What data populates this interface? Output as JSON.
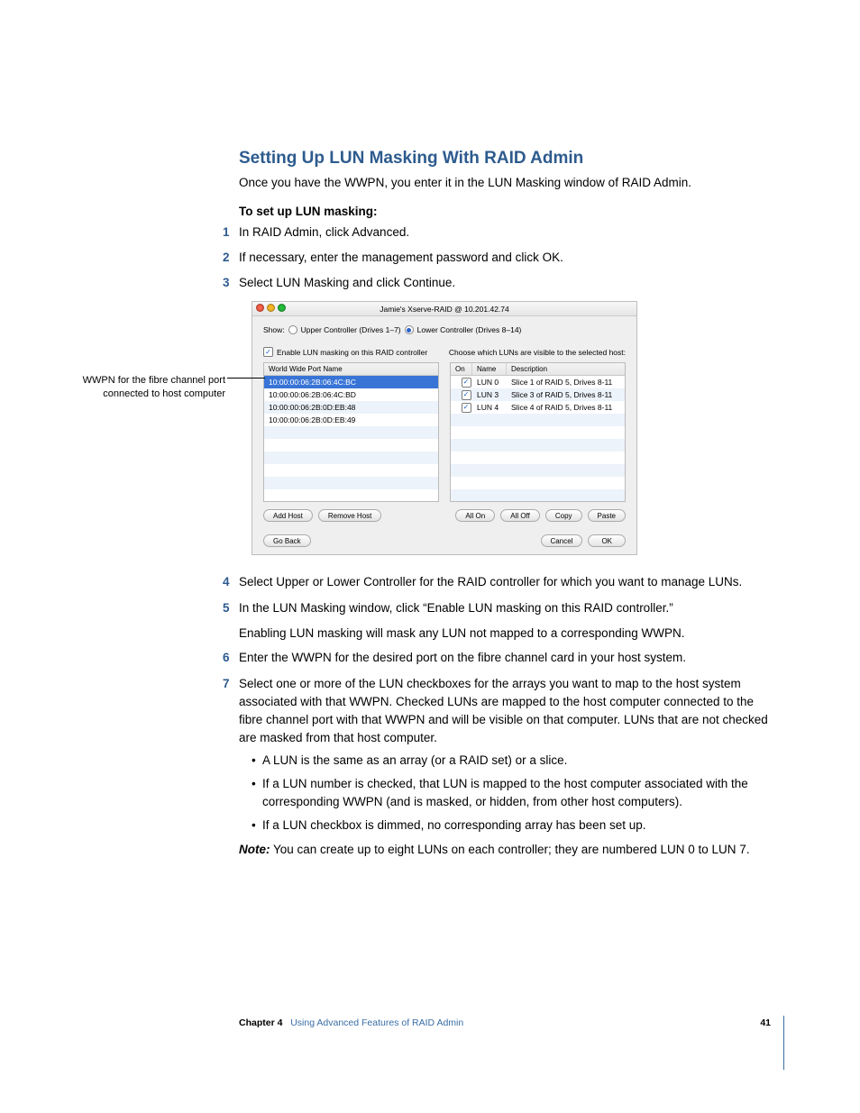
{
  "heading": "Setting Up LUN Masking With RAID Admin",
  "intro": "Once you have the WWPN, you enter it in the LUN Masking window of RAID Admin.",
  "sub_head": "To set up LUN masking:",
  "steps_a": [
    "In RAID Admin, click Advanced.",
    "If necessary, enter the management password and click OK.",
    "Select LUN Masking and click Continue."
  ],
  "callout": "WWPN for the fibre channel port connected to host computer",
  "dialog": {
    "title": "Jamie's Xserve-RAID @ 10.201.42.74",
    "show_label": "Show:",
    "upper_label": "Upper Controller (Drives 1–7)",
    "lower_label": "Lower Controller (Drives 8–14)",
    "enable_label": "Enable LUN masking on this RAID controller",
    "choose_label": "Choose which LUNs are visible to the selected host:",
    "left_header": "World Wide Port Name",
    "wwpns": [
      "10:00:00:06:2B:06:4C:BC",
      "10:00:00:06:2B:06:4C:BD",
      "10:00:00:06:2B:0D:EB:48",
      "10:00:00:06:2B:0D:EB:49"
    ],
    "right_headers": {
      "on": "On",
      "name": "Name",
      "desc": "Description"
    },
    "luns": [
      {
        "name": "LUN 0",
        "desc": "Slice 1 of RAID 5, Drives 8-11"
      },
      {
        "name": "LUN 3",
        "desc": "Slice 3 of RAID 5, Drives 8-11"
      },
      {
        "name": "LUN 4",
        "desc": "Slice 4 of RAID 5, Drives 8-11"
      }
    ],
    "btns": {
      "add_host": "Add Host",
      "remove_host": "Remove Host",
      "all_on": "All On",
      "all_off": "All Off",
      "copy": "Copy",
      "paste": "Paste",
      "go_back": "Go Back",
      "cancel": "Cancel",
      "ok": "OK"
    }
  },
  "steps_b": [
    {
      "n": "4",
      "t": "Select Upper or Lower Controller for the RAID controller for which you want to manage LUNs."
    },
    {
      "n": "5",
      "t": "In the LUN Masking window, click “Enable LUN masking on this RAID controller.”"
    }
  ],
  "after5": "Enabling LUN masking will mask any LUN not mapped to a corresponding WWPN.",
  "steps_c": [
    {
      "n": "6",
      "t": "Enter the WWPN for the desired port on the fibre channel card in your host system."
    },
    {
      "n": "7",
      "t": "Select one or more of the LUN checkboxes for the arrays you want to map to the host system associated with that WWPN. Checked LUNs are mapped to the host computer connected to the fibre channel port with that WWPN and will be visible on that computer. LUNs that are not checked are masked from that host computer."
    }
  ],
  "bullets": [
    "A LUN is the same as an array (or a RAID set) or a slice.",
    "If a LUN number is checked, that LUN is mapped to the host computer associated with the corresponding WWPN (and is masked, or hidden, from other host computers).",
    "If a LUN checkbox is dimmed, no corresponding array has been set up."
  ],
  "note_label": "Note:",
  "note_body": "  You can create up to eight LUNs on each controller; they are numbered LUN 0 to LUN 7.",
  "footer": {
    "chapter": "Chapter 4",
    "title": "Using Advanced Features of RAID Admin",
    "page": "41"
  }
}
